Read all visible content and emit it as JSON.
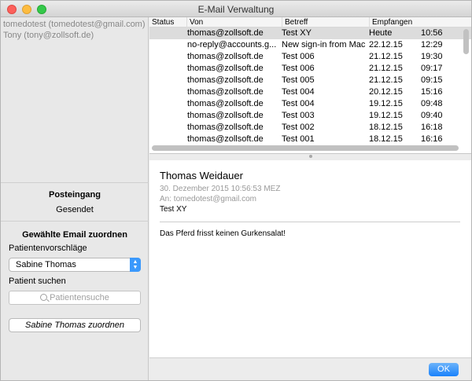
{
  "window": {
    "title": "E-Mail Verwaltung"
  },
  "sidebar": {
    "accounts": [
      "tomedotest (tomedotest@gmail.com)",
      "Tony (tony@zollsoft.de)"
    ],
    "folders": [
      {
        "label": "Posteingang",
        "selected": true
      },
      {
        "label": "Gesendet",
        "selected": false
      }
    ],
    "assign": {
      "title": "Gewählte Email zuordnen",
      "suggestions_label": "Patientenvorschläge",
      "suggestion_selected": "Sabine Thomas",
      "search_label": "Patient suchen",
      "search_placeholder": "Patientensuche",
      "assign_button": "Sabine Thomas zuordnen"
    }
  },
  "table": {
    "columns": [
      "Status",
      "Von",
      "Betreff",
      "Empfangen"
    ],
    "rows": [
      {
        "status": "",
        "from": "thomas@zollsoft.de",
        "subject": "Test XY",
        "date": "Heute",
        "time": "10:56",
        "selected": true
      },
      {
        "status": "",
        "from": "no-reply@accounts.g...",
        "subject": "New sign-in from Mac",
        "date": "22.12.15",
        "time": "12:29"
      },
      {
        "status": "",
        "from": "thomas@zollsoft.de",
        "subject": "Test 006",
        "date": "21.12.15",
        "time": "19:30"
      },
      {
        "status": "",
        "from": "thomas@zollsoft.de",
        "subject": "Test 006",
        "date": "21.12.15",
        "time": "09:17"
      },
      {
        "status": "",
        "from": "thomas@zollsoft.de",
        "subject": "Test 005",
        "date": "21.12.15",
        "time": "09:15"
      },
      {
        "status": "",
        "from": "thomas@zollsoft.de",
        "subject": "Test 004",
        "date": "20.12.15",
        "time": "15:16"
      },
      {
        "status": "",
        "from": "thomas@zollsoft.de",
        "subject": "Test 004",
        "date": "19.12.15",
        "time": "09:48"
      },
      {
        "status": "",
        "from": "thomas@zollsoft.de",
        "subject": "Test 003",
        "date": "19.12.15",
        "time": "09:40"
      },
      {
        "status": "",
        "from": "thomas@zollsoft.de",
        "subject": "Test 002",
        "date": "18.12.15",
        "time": "16:18"
      },
      {
        "status": "",
        "from": "thomas@zollsoft.de",
        "subject": "Test 001",
        "date": "18.12.15",
        "time": "16:16"
      }
    ]
  },
  "preview": {
    "from": "Thomas Weidauer",
    "date": "30. Dezember 2015 10:56:53 MEZ",
    "to": "An: tomedotest@gmail.com",
    "subject": "Test XY",
    "body": "Das Pferd frisst keinen Gurkensalat!"
  },
  "footer": {
    "ok_label": "OK"
  },
  "colors": {
    "accent": "#1a82fb",
    "selected_row": "#dcdcdc"
  }
}
